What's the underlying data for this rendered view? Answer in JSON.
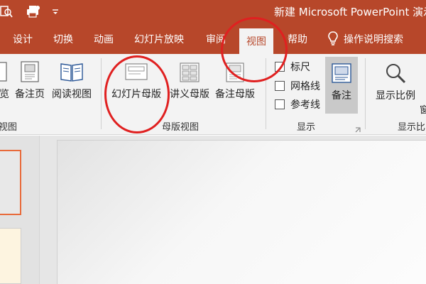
{
  "window": {
    "title": "新建 Microsoft PowerPoint 演示",
    "qat_icons": [
      "print-preview-icon",
      "print-icon",
      "customize-toolbar-icon"
    ]
  },
  "tabs": [
    {
      "label": "设计",
      "active": false
    },
    {
      "label": "切换",
      "active": false
    },
    {
      "label": "动画",
      "active": false
    },
    {
      "label": "幻灯片放映",
      "active": false
    },
    {
      "label": "审阅",
      "active": false
    },
    {
      "label": "视图",
      "active": true
    },
    {
      "label": "帮助",
      "active": false
    }
  ],
  "tell_me": {
    "label": "操作说明搜索",
    "icon": "lightbulb-icon"
  },
  "ribbon": {
    "presentation_views": {
      "label": "视图",
      "buttons": [
        {
          "label": "览",
          "icon": "slide-sorter-icon"
        },
        {
          "label": "备注页",
          "icon": "notes-page-icon"
        },
        {
          "label": "阅读视图",
          "icon": "reading-view-icon"
        }
      ]
    },
    "master_views": {
      "label": "母版视图",
      "buttons": [
        {
          "label": "幻灯片母版",
          "icon": "slide-master-icon"
        },
        {
          "label": "讲义母版",
          "icon": "handout-master-icon"
        },
        {
          "label": "备注母版",
          "icon": "notes-master-icon"
        }
      ]
    },
    "show": {
      "label": "显示",
      "checkboxes": [
        {
          "label": "标尺",
          "checked": false
        },
        {
          "label": "网格线",
          "checked": false
        },
        {
          "label": "参考线",
          "checked": false
        }
      ],
      "notes_button": {
        "label": "备注",
        "icon": "notes-icon",
        "pressed": true
      }
    },
    "zoom": {
      "label": "显示比",
      "buttons": [
        {
          "label": "显示比例",
          "icon": "zoom-icon"
        },
        {
          "label": "窗",
          "icon": "fit-window-icon"
        }
      ]
    }
  },
  "colors": {
    "accent": "#b7472a",
    "annotation": "#e02020",
    "selected_thumb_border": "#e86a3a"
  }
}
